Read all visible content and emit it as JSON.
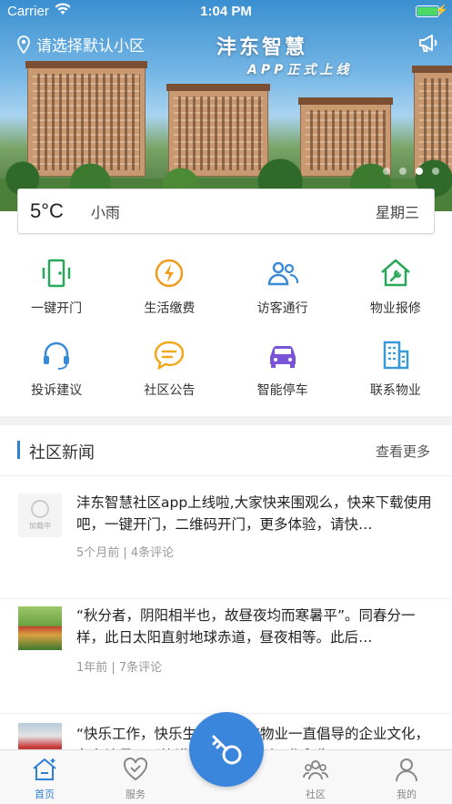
{
  "status_bar": {
    "carrier": "Carrier",
    "time": "1:04 PM"
  },
  "banner": {
    "location_prompt": "请选择默认小区",
    "headline": "沣东智慧",
    "subline": "APP正式上线",
    "slide_count": 4,
    "active_slide": 3
  },
  "weather": {
    "temperature": "5°C",
    "condition": "小雨",
    "weekday": "星期三"
  },
  "services": [
    {
      "label": "一键开门",
      "icon": "door-icon",
      "color": "#2aa85a"
    },
    {
      "label": "生活缴费",
      "icon": "lightning-icon",
      "color": "#f29a1d"
    },
    {
      "label": "访客通行",
      "icon": "visitors-icon",
      "color": "#3a8ad6"
    },
    {
      "label": "物业报修",
      "icon": "repair-house-icon",
      "color": "#2aa85a"
    },
    {
      "label": "投诉建议",
      "icon": "headset-icon",
      "color": "#3a8ad6"
    },
    {
      "label": "社区公告",
      "icon": "chat-bubble-icon",
      "color": "#f2a81d"
    },
    {
      "label": "智能停车",
      "icon": "car-icon",
      "color": "#7a54d8"
    },
    {
      "label": "联系物业",
      "icon": "building-icon",
      "color": "#3a9ad6"
    }
  ],
  "news": {
    "title": "社区新闻",
    "more": "查看更多",
    "items": [
      {
        "text": "沣东智慧社区app上线啦,大家快来围观么，快来下载使用吧，一键开门，二维码开门，更多体验，请快…",
        "meta": "5个月前 | 4条评论",
        "thumb_caption": "加载中"
      },
      {
        "text": "“秋分者，阴阳相半也，故昼夜均而寒暑平”。同春分一样，此日太阳直射地球赤道，昼夜相等。此后…",
        "meta": "1年前 | 7条评论"
      },
      {
        "text": "“快乐工作，快乐生活”是沣东物业一直倡导的企业文化，各在让员工以饱满的状态投入到工作和生…",
        "meta": ""
      }
    ]
  },
  "tabbar": [
    {
      "label": "首页",
      "icon": "home-icon",
      "active": true
    },
    {
      "label": "服务",
      "icon": "heart-icon",
      "active": false
    },
    {
      "label": "社区",
      "icon": "community-icon",
      "active": false
    },
    {
      "label": "我的",
      "icon": "profile-icon",
      "active": false
    }
  ],
  "colors": {
    "accent": "#3a86dc",
    "active_tab": "#2f7fd8"
  }
}
